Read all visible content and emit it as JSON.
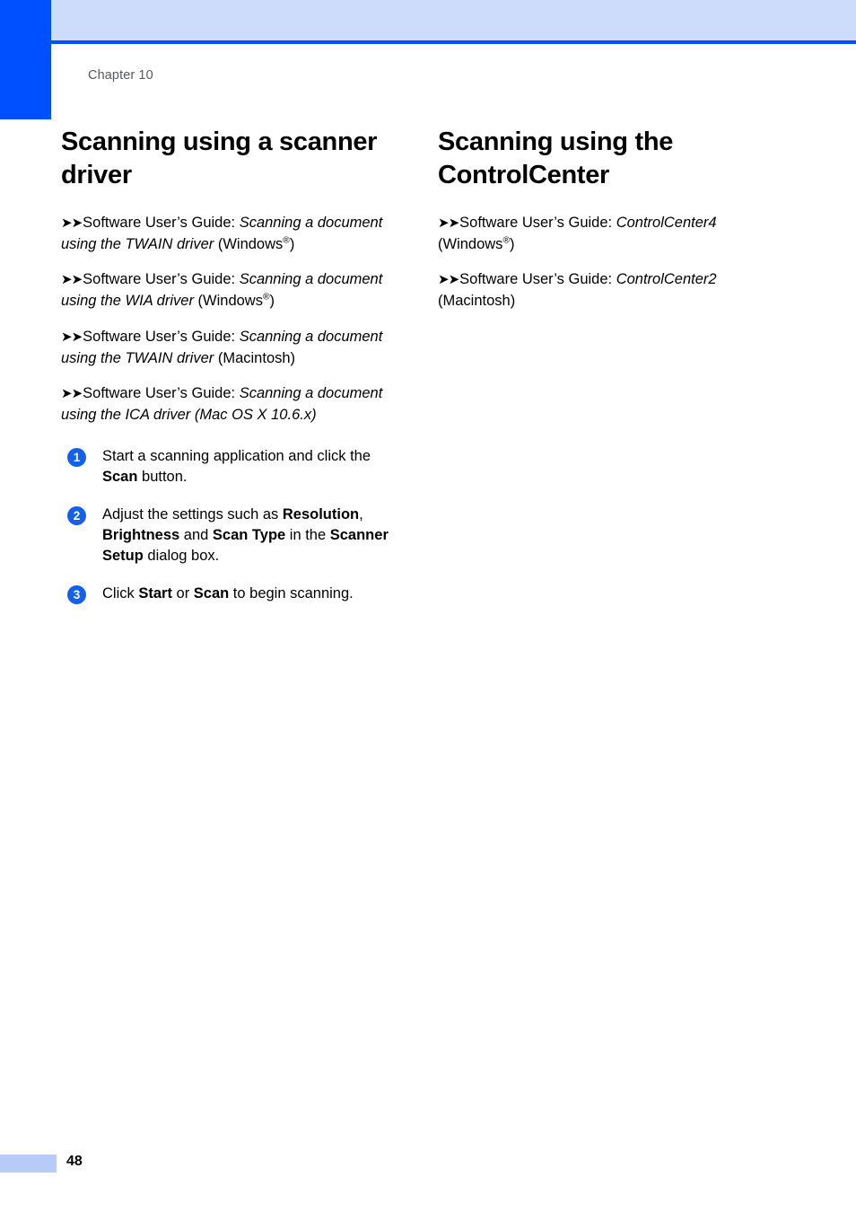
{
  "page": {
    "chapter_label": "Chapter 10",
    "page_number": "48",
    "accent_color": "#0050ff",
    "band_color": "#ccdcfa",
    "footer_bar_color": "#b6cbf7",
    "badge_color": "#1560e8"
  },
  "left_column": {
    "title": "Scanning using a scanner driver",
    "xrefs": [
      {
        "arrows": "➤➤",
        "prefix": "Software User’s Guide: ",
        "italic": "Scanning a document using the TWAIN driver",
        "suffix_before_reg": " (Windows",
        "registered": "®",
        "suffix_after_reg": ")"
      },
      {
        "arrows": "➤➤",
        "prefix": "Software User’s Guide: ",
        "italic": "Scanning a document using the WIA driver",
        "suffix_before_reg": " (Windows",
        "registered": "®",
        "suffix_after_reg": ")"
      },
      {
        "arrows": "➤➤",
        "prefix": "Software User’s Guide: ",
        "italic": "Scanning a document using the TWAIN driver",
        "suffix_before_reg": " (Macintosh)",
        "registered": "",
        "suffix_after_reg": ""
      },
      {
        "arrows": "➤➤",
        "prefix": "Software User’s Guide: ",
        "italic": "Scanning a document using the ICA driver (Mac OS X 10.6.x)",
        "suffix_before_reg": "",
        "registered": "",
        "suffix_after_reg": ""
      }
    ],
    "steps": [
      {
        "number": "1",
        "parts": [
          {
            "text": "Start a scanning application and click the ",
            "bold": false
          },
          {
            "text": "Scan",
            "bold": true
          },
          {
            "text": " button.",
            "bold": false
          }
        ]
      },
      {
        "number": "2",
        "parts": [
          {
            "text": "Adjust the settings such as ",
            "bold": false
          },
          {
            "text": "Resolution",
            "bold": true
          },
          {
            "text": ", ",
            "bold": false
          },
          {
            "text": "Brightness",
            "bold": true
          },
          {
            "text": " and ",
            "bold": false
          },
          {
            "text": "Scan Type",
            "bold": true
          },
          {
            "text": " in the ",
            "bold": false
          },
          {
            "text": "Scanner Setup",
            "bold": true
          },
          {
            "text": " dialog box.",
            "bold": false
          }
        ]
      },
      {
        "number": "3",
        "parts": [
          {
            "text": "Click ",
            "bold": false
          },
          {
            "text": "Start",
            "bold": true
          },
          {
            "text": " or ",
            "bold": false
          },
          {
            "text": "Scan",
            "bold": true
          },
          {
            "text": " to begin scanning.",
            "bold": false
          }
        ]
      }
    ]
  },
  "right_column": {
    "title": "Scanning using the ControlCenter",
    "xrefs": [
      {
        "arrows": "➤➤",
        "prefix": "Software User’s Guide: ",
        "italic": "ControlCenter4",
        "suffix_before_reg": " (Windows",
        "registered": "®",
        "suffix_after_reg": ")"
      },
      {
        "arrows": "➤➤",
        "prefix": "Software User’s Guide: ",
        "italic": "ControlCenter2",
        "suffix_before_reg": " (Macintosh)",
        "registered": "",
        "suffix_after_reg": ""
      }
    ]
  }
}
